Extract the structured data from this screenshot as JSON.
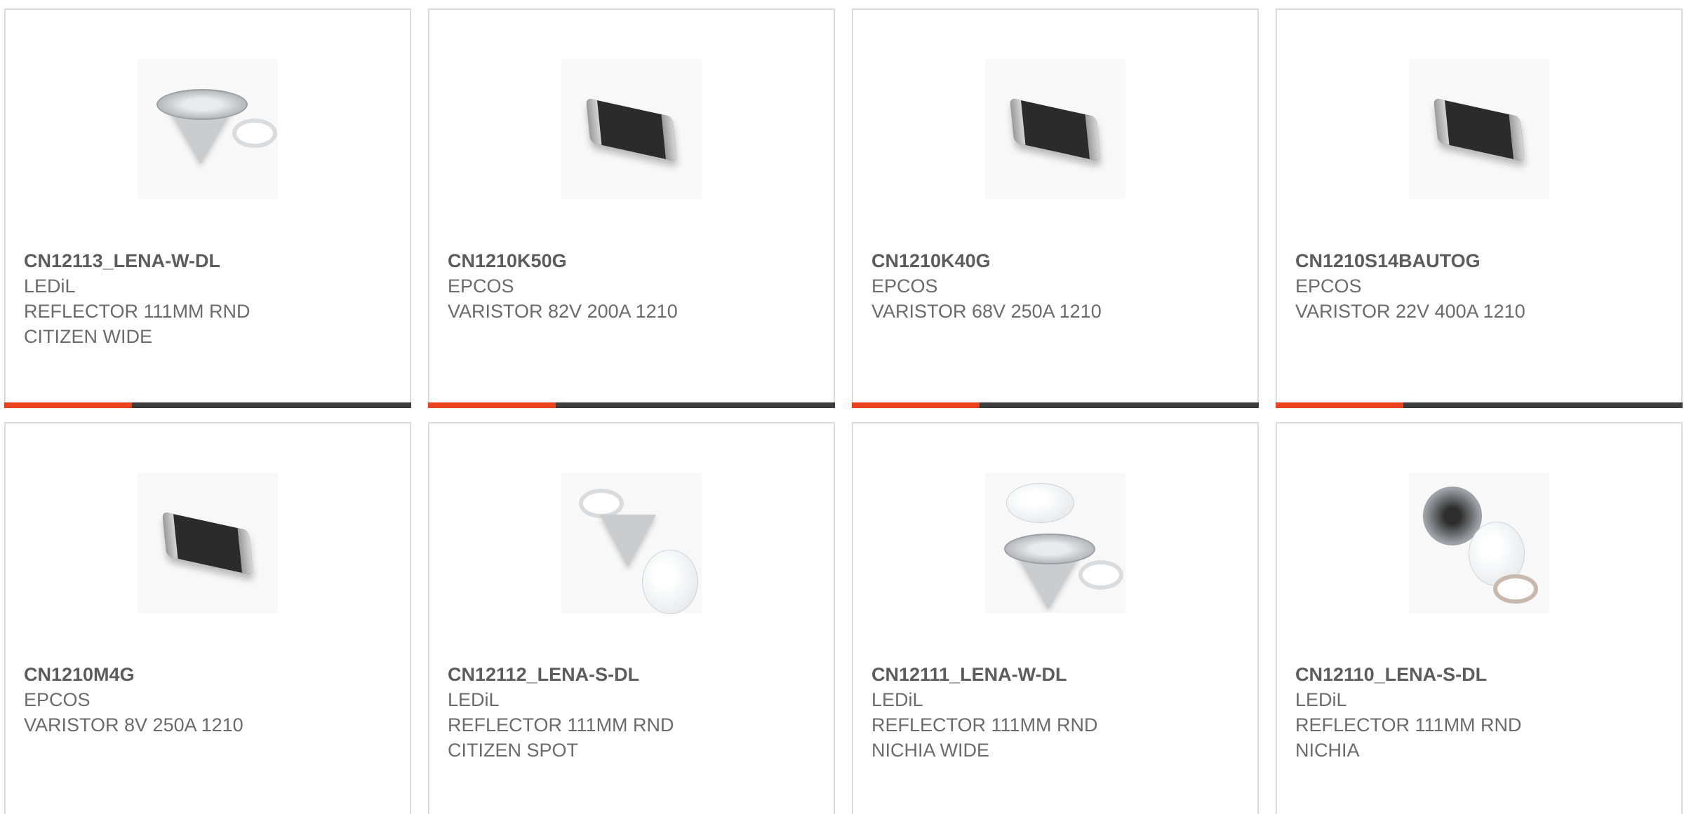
{
  "products": [
    {
      "part_number": "CN12113_LENA-W-DL",
      "manufacturer": "LEDiL",
      "desc1": "REFLECTOR 111MM RND",
      "desc2": "CITIZEN WIDE",
      "icon": "reflector-image"
    },
    {
      "part_number": "CN1210K50G",
      "manufacturer": "EPCOS",
      "desc1": "VARISTOR 82V 200A 1210",
      "desc2": "",
      "icon": "varistor-chip-image"
    },
    {
      "part_number": "CN1210K40G",
      "manufacturer": "EPCOS",
      "desc1": "VARISTOR 68V 250A 1210",
      "desc2": "",
      "icon": "varistor-chip-image"
    },
    {
      "part_number": "CN1210S14BAUTOG",
      "manufacturer": "EPCOS",
      "desc1": "VARISTOR 22V 400A 1210",
      "desc2": "",
      "icon": "varistor-chip-image"
    },
    {
      "part_number": "CN1210M4G",
      "manufacturer": "EPCOS",
      "desc1": "VARISTOR 8V 250A 1210",
      "desc2": "",
      "icon": "varistor-chip-image"
    },
    {
      "part_number": "CN12112_LENA-S-DL",
      "manufacturer": "LEDiL",
      "desc1": "REFLECTOR 111MM RND",
      "desc2": "CITIZEN SPOT",
      "icon": "reflector-image"
    },
    {
      "part_number": "CN12111_LENA-W-DL",
      "manufacturer": "LEDiL",
      "desc1": "REFLECTOR 111MM RND",
      "desc2": "NICHIA WIDE",
      "icon": "reflector-image"
    },
    {
      "part_number": "CN12110_LENA-S-DL",
      "manufacturer": "LEDiL",
      "desc1": "REFLECTOR 111MM RND",
      "desc2": "NICHIA",
      "icon": "reflector-image"
    }
  ],
  "colors": {
    "accent": "#e8421e",
    "bar": "#3d3d3d",
    "text": "#6b6b6b",
    "border": "#dcdcdc"
  }
}
